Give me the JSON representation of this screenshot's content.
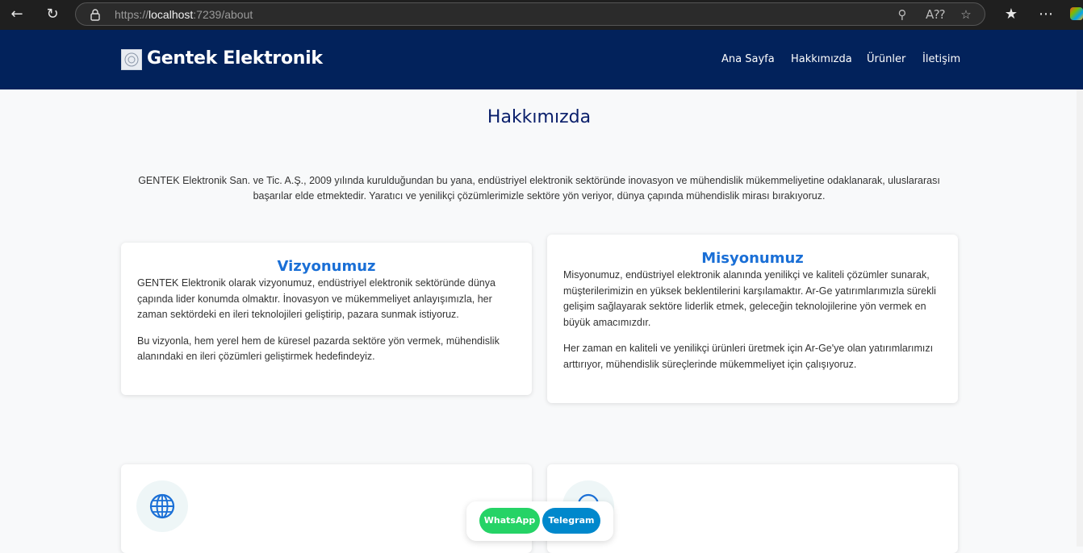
{
  "browser": {
    "url_prefix": "https://",
    "url_host": "localhost",
    "url_path": ":7239/about"
  },
  "site": {
    "brand": "Gentek Elektronik",
    "nav": [
      "Ana Sayfa",
      "Hakkımızda",
      "Ürünler",
      "İletişim"
    ]
  },
  "page": {
    "title": "Hakkımızda",
    "intro": "GENTEK Elektronik San. ve Tic. A.Ş., 2009 yılında kurulduğundan bu yana, endüstriyel elektronik sektöründe inovasyon ve mühendislik mükemmeliyetine odaklanarak, uluslararası başarılar elde etmektedir. Yaratıcı ve yenilikçi çözümlerimizle sektöre yön veriyor, dünya çapında mühendislik mirası bırakıyoruz."
  },
  "vision": {
    "title": "Vizyonumuz",
    "p1": "GENTEK Elektronik olarak vizyonumuz, endüstriyel elektronik sektöründe dünya çapında lider konumda olmaktır. İnovasyon ve mükemmeliyet anlayışımızla, her zaman sektördeki en ileri teknolojileri geliştirip, pazara sunmak istiyoruz.",
    "p2": "Bu vizyonla, hem yerel hem de küresel pazarda sektöre yön vermek, mühendislik alanındaki en ileri çözümleri geliştirmek hedefindeyiz."
  },
  "mission": {
    "title": "Misyonumuz",
    "p1": "Misyonumuz, endüstriyel elektronik alanında yenilikçi ve kaliteli çözümler sunarak, müşterilerimizin en yüksek beklentilerini karşılamaktır. Ar-Ge yatırımlarımızla sürekli gelişim sağlayarak sektöre liderlik etmek, geleceğin teknolojilerine yön vermek en büyük amacımızdır.",
    "p2": "Her zaman en kaliteli ve yenilikçi ürünleri üretmek için Ar-Ge'ye olan yatırımlarımızı arttırıyor, mühendislik süreçlerinde mükemmeliyet için çalışıyoruz."
  },
  "contact_buttons": {
    "whatsapp": "WhatsApp",
    "telegram": "Telegram"
  },
  "colors": {
    "navbar": "#02225b",
    "accent": "#1a6fd6",
    "whatsapp": "#25d366",
    "telegram": "#0088cc"
  },
  "icons": [
    "back-arrow-icon",
    "refresh-icon",
    "lock-icon",
    "zoom-icon",
    "read-aloud-icon",
    "favorite-star-icon",
    "favorites-list-icon",
    "more-menu-icon",
    "globe-icon",
    "info-circle-icon"
  ]
}
